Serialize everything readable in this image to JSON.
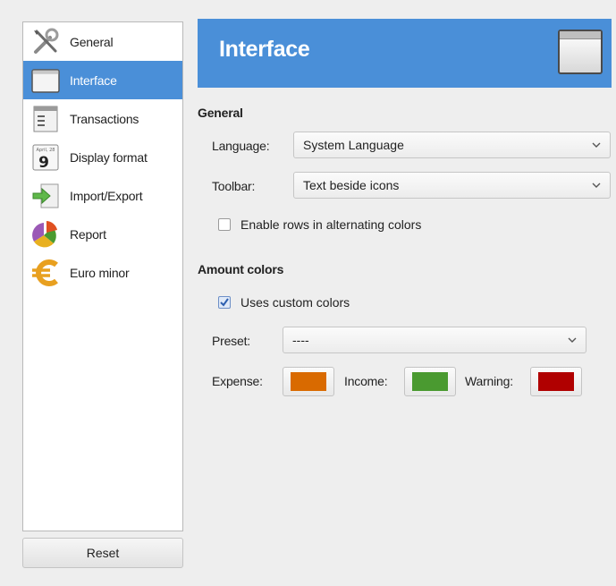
{
  "sidebar": {
    "items": [
      {
        "label": "General",
        "icon": "wrench-screwdriver-icon",
        "active": false
      },
      {
        "label": "Interface",
        "icon": "window-icon",
        "active": true
      },
      {
        "label": "Transactions",
        "icon": "document-list-icon",
        "active": false
      },
      {
        "label": "Display format",
        "icon": "calendar-icon",
        "active": false
      },
      {
        "label": "Import/Export",
        "icon": "import-export-icon",
        "active": false
      },
      {
        "label": "Report",
        "icon": "pie-chart-icon",
        "active": false
      },
      {
        "label": "Euro minor",
        "icon": "euro-icon",
        "active": false
      }
    ],
    "calendar_icon_text": {
      "month": "April, 28",
      "day": "9"
    }
  },
  "reset_label": "Reset",
  "header": {
    "title": "Interface"
  },
  "general": {
    "section_title": "General",
    "language_label": "Language:",
    "language_value": "System Language",
    "toolbar_label": "Toolbar:",
    "toolbar_value": "Text beside icons",
    "alternating_label": "Enable rows in alternating colors",
    "alternating_checked": false
  },
  "amount_colors": {
    "section_title": "Amount colors",
    "custom_label": "Uses custom colors",
    "custom_checked": true,
    "preset_label": "Preset:",
    "preset_value": "----",
    "expense_label": "Expense:",
    "income_label": "Income:",
    "warning_label": "Warning:",
    "expense_color": "#d96a00",
    "income_color": "#4a9a30",
    "warning_color": "#b00000"
  },
  "colors": {
    "accent": "#4a8fd8"
  }
}
